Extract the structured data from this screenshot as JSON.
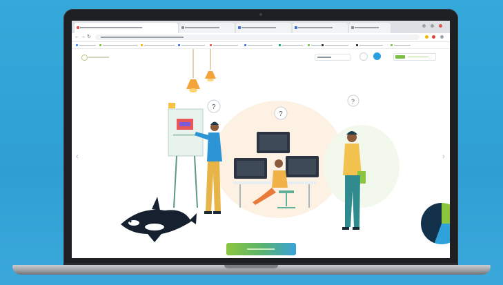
{
  "colors": {
    "background": "#35a9db",
    "laptop_frame": "#1e1f22",
    "accent_green": "#8cc63f",
    "accent_blue": "#2c9fe0",
    "navy": "#13314a"
  },
  "browser": {
    "tab_count": 5,
    "window_controls": [
      "minimize-icon",
      "maximize-icon",
      "close-icon"
    ]
  },
  "site": {
    "header_icons": [
      "logo-icon",
      "search-icon",
      "help-icon"
    ]
  },
  "illustration": {
    "scene": "office-team",
    "elements": [
      "presenter-person",
      "whiteboard",
      "desk-with-monitors",
      "seated-person",
      "standing-person-with-folder",
      "orca",
      "pendant-lamps",
      "question-bubbles"
    ]
  }
}
